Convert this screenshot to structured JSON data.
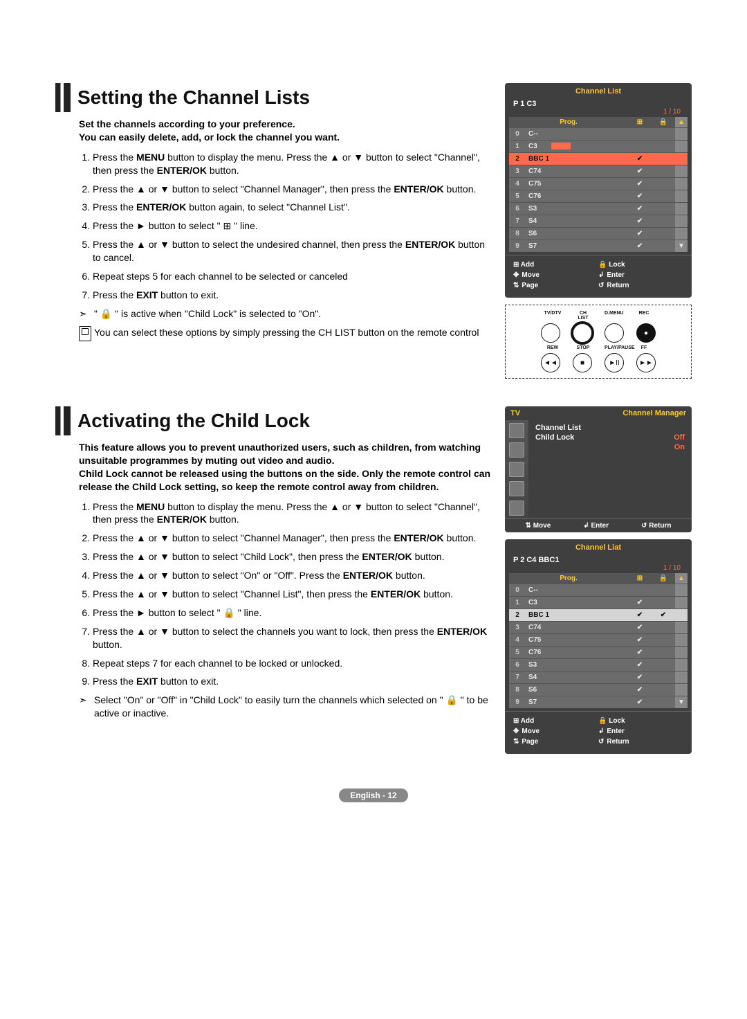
{
  "section1": {
    "title": "Setting the Channel Lists",
    "intro": "Set the channels according to your preference.\nYou can easily delete, add, or lock the channel you want.",
    "steps": [
      "Press the MENU button to display the menu. Press the ▲ or ▼ button to select \"Channel\", then press the ENTER/OK button.",
      "Press the ▲ or ▼ button to select \"Channel Manager\", then press the ENTER/OK button.",
      "Press the ENTER/OK button again, to select \"Channel List\".",
      "Press the ► button to select \" ⊞ \" line.",
      "Press the ▲ or ▼ button to select the undesired channel, then press the ENTER/OK button to cancel.",
      "Repeat steps 5 for each channel to be selected or canceled",
      "Press the EXIT button to exit."
    ],
    "note1": "\" 🔒 \" is active when \"Child Lock\" is selected to \"On\".",
    "note2": "You can select these options by simply pressing the CH LIST button on the remote control"
  },
  "section2": {
    "title": "Activating the Child Lock",
    "intro": "This feature allows you to prevent unauthorized users, such as children, from watching unsuitable programmes by muting out video and audio.\nChild Lock cannot be released using the buttons on the side. Only the remote control can release the Child Lock setting, so keep the remote control away from children.",
    "steps": [
      "Press the MENU button to display the menu. Press the ▲ or ▼ button to select \"Channel\", then press the ENTER/OK button.",
      "Press the ▲ or ▼ button to select \"Channel Manager\", then press the ENTER/OK button.",
      "Press the ▲ or ▼ button to select \"Child Lock\", then press the ENTER/OK button.",
      "Press the ▲ or ▼ button to select \"On\" or \"Off\". Press the ENTER/OK button.",
      "Press the ▲ or ▼ button to select \"Channel List\", then press the ENTER/OK button.",
      "Press the ► button to select \" 🔒 \" line.",
      "Press the ▲ or ▼ button to select the channels you want to lock, then press the ENTER/OK button.",
      "Repeat steps 7 for each channel to be locked or unlocked.",
      "Press the EXIT button to exit."
    ],
    "note": "Select \"On\" or \"Off\" in \"Child Lock\" to easily turn the channels which selected on \" 🔒 \" to be active or inactive."
  },
  "osd1": {
    "title": "Channel List",
    "current": "P  1   C3",
    "page": "1 / 10",
    "headers": {
      "prog": "Prog.",
      "add": "⊞",
      "lock": "🔒"
    },
    "rows": [
      {
        "n": "0",
        "name": "C--",
        "ck": "",
        "lk": "",
        "hl": false
      },
      {
        "n": "1",
        "name": "C3",
        "ck": "",
        "lk": "",
        "hl": false,
        "sel": true
      },
      {
        "n": "2",
        "name": "BBC 1",
        "ck": "✔",
        "lk": "",
        "hl": true
      },
      {
        "n": "3",
        "name": "C74",
        "ck": "✔",
        "lk": "",
        "hl": false
      },
      {
        "n": "4",
        "name": "C75",
        "ck": "✔",
        "lk": "",
        "hl": false
      },
      {
        "n": "5",
        "name": "C76",
        "ck": "✔",
        "lk": "",
        "hl": false
      },
      {
        "n": "6",
        "name": "S3",
        "ck": "✔",
        "lk": "",
        "hl": false
      },
      {
        "n": "7",
        "name": "S4",
        "ck": "✔",
        "lk": "",
        "hl": false
      },
      {
        "n": "8",
        "name": "S6",
        "ck": "✔",
        "lk": "",
        "hl": false
      },
      {
        "n": "9",
        "name": "S7",
        "ck": "✔",
        "lk": "",
        "hl": false
      }
    ],
    "footer": {
      "add": "⊞ Add",
      "lock": "🔒 Lock",
      "move": "Move",
      "enter": "Enter",
      "page": "Page",
      "return": "Return"
    }
  },
  "remote": {
    "row1": [
      "TV/DTV",
      "CH LIST",
      "D.MENU",
      "REC"
    ],
    "row2": [
      "REW",
      "STOP",
      "PLAY/PAUSE",
      "FF"
    ]
  },
  "osd2": {
    "left": "TV",
    "right": "Channel Manager",
    "rows": [
      {
        "label": "Channel List",
        "opt": ""
      },
      {
        "label": "Child Lock",
        "opt": "Off"
      },
      {
        "label": "",
        "opt": "On"
      }
    ],
    "bottom": {
      "move": "Move",
      "enter": "Enter",
      "return": "Return"
    }
  },
  "osd3": {
    "title": "Channel Liat",
    "current": "P  2   C4      BBC1",
    "page": "1 / 10",
    "headers": {
      "prog": "Prog.",
      "add": "⊞",
      "lock": "🔒"
    },
    "rows": [
      {
        "n": "0",
        "name": "C--",
        "ck": "",
        "lk": ""
      },
      {
        "n": "1",
        "name": "C3",
        "ck": "✔",
        "lk": ""
      },
      {
        "n": "2",
        "name": "BBC 1",
        "ck": "✔",
        "lk": "✔",
        "hl2": true
      },
      {
        "n": "3",
        "name": "C74",
        "ck": "✔",
        "lk": ""
      },
      {
        "n": "4",
        "name": "C75",
        "ck": "✔",
        "lk": ""
      },
      {
        "n": "5",
        "name": "C76",
        "ck": "✔",
        "lk": ""
      },
      {
        "n": "6",
        "name": "S3",
        "ck": "✔",
        "lk": ""
      },
      {
        "n": "7",
        "name": "S4",
        "ck": "✔",
        "lk": ""
      },
      {
        "n": "8",
        "name": "S6",
        "ck": "✔",
        "lk": ""
      },
      {
        "n": "9",
        "name": "S7",
        "ck": "✔",
        "lk": ""
      }
    ],
    "footer": {
      "add": "⊞ Add",
      "lock": "🔒 Lock",
      "move": "Move",
      "enter": "Enter",
      "page": "Page",
      "return": "Return"
    }
  },
  "pagenum": "English - 12"
}
